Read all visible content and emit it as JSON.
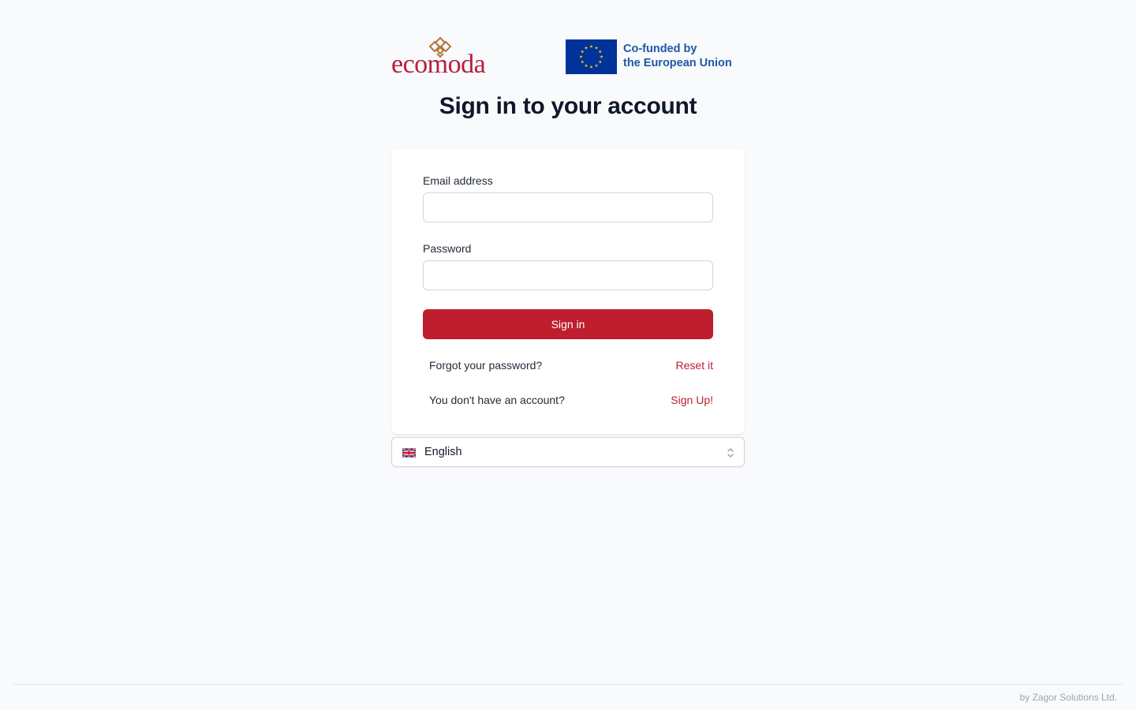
{
  "logos": {
    "brand_name": "ecomoda",
    "eu_line1": "Co-funded by",
    "eu_line2": "the European Union"
  },
  "page_title": "Sign in to your account",
  "form": {
    "email_label": "Email address",
    "email_value": "",
    "password_label": "Password",
    "password_value": "",
    "signin_label": "Sign in"
  },
  "links": {
    "forgot_text": "Forgot your password?",
    "reset_label": "Reset it",
    "no_account_text": "You don't have an account?",
    "signup_label": "Sign Up!"
  },
  "language": {
    "selected": "English",
    "flag_icon": "uk-flag-icon"
  },
  "footer": {
    "credit": "by Zagor Solutions Ltd."
  },
  "colors": {
    "accent": "#be1e2d",
    "background": "#f8fafc",
    "eu_blue": "#003399",
    "eu_star": "#ffcc00"
  }
}
